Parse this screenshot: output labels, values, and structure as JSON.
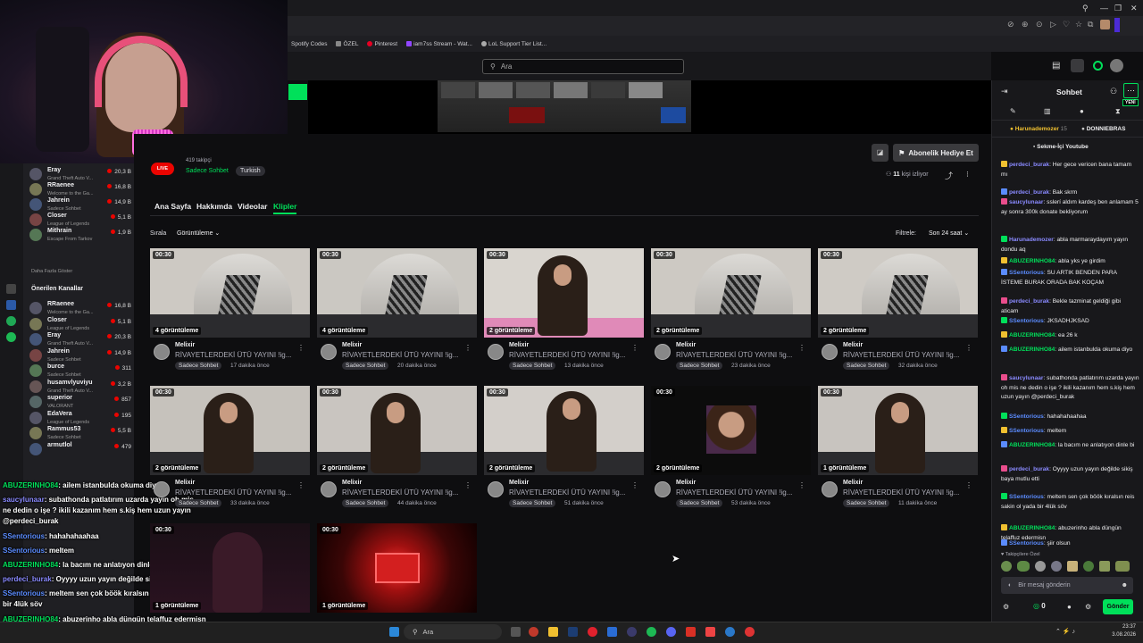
{
  "browser": {
    "bookmarks": [
      "Spotify Codes",
      "ÖZEL",
      "Pinterest",
      "iam7ss Stream - Wat...",
      "LoL Support Tier List..."
    ]
  },
  "topnav": {
    "search_placeholder": "Ara"
  },
  "channel": {
    "tags": [
      "Sadece Sohbet",
      "Turkish"
    ],
    "live_badge": "LIVE",
    "followers_partial": "419 takipçi",
    "gift_button": "Abonelik Hediye Et",
    "viewers_count": "11",
    "viewers_label": "kişi izliyor"
  },
  "tabs": [
    "Ana Sayfa",
    "Hakkımda",
    "Videolar",
    "Klipler"
  ],
  "active_tab": "Klipler",
  "sort": {
    "label": "Sırala",
    "value": "Görüntüleme"
  },
  "filter": {
    "label": "Filtrele:",
    "value": "Son 24 saat"
  },
  "clips": [
    {
      "dur": "00:30",
      "views": "4 görüntüleme",
      "channel": "Melixir",
      "title": "RİVAYETLERDEKİ ÜTÜ YAYINI !ig...",
      "tag": "Sadece Sohbet",
      "ago": "17 dakika önce"
    },
    {
      "dur": "00:30",
      "views": "4 görüntüleme",
      "channel": "Melixir",
      "title": "RİVAYETLERDEKİ ÜTÜ YAYINI !ig...",
      "tag": "Sadece Sohbet",
      "ago": "20 dakika önce"
    },
    {
      "dur": "00:30",
      "views": "2 görüntüleme",
      "channel": "Melixir",
      "title": "RİVAYETLERDEKİ ÜTÜ YAYINI !ig...",
      "tag": "Sadece Sohbet",
      "ago": "13 dakika önce"
    },
    {
      "dur": "00:30",
      "views": "2 görüntüleme",
      "channel": "Melixir",
      "title": "RİVAYETLERDEKİ ÜTÜ YAYINI !ig...",
      "tag": "Sadece Sohbet",
      "ago": "23 dakika önce"
    },
    {
      "dur": "00:30",
      "views": "2 görüntüleme",
      "channel": "Melixir",
      "title": "RİVAYETLERDEKİ ÜTÜ YAYINI !ig...",
      "tag": "Sadece Sohbet",
      "ago": "32 dakika önce"
    },
    {
      "dur": "00:30",
      "views": "2 görüntüleme",
      "channel": "Melixir",
      "title": "RİVAYETLERDEKİ ÜTÜ YAYINI !ig...",
      "tag": "Sadece Sohbet",
      "ago": "33 dakika önce"
    },
    {
      "dur": "00:30",
      "views": "2 görüntüleme",
      "channel": "Melixir",
      "title": "RİVAYETLERDEKİ ÜTÜ YAYINI !ig...",
      "tag": "Sadece Sohbet",
      "ago": "44 dakika önce"
    },
    {
      "dur": "00:30",
      "views": "2 görüntüleme",
      "channel": "Melixir",
      "title": "RİVAYETLERDEKİ ÜTÜ YAYINI !ig...",
      "tag": "Sadece Sohbet",
      "ago": "51 dakika önce"
    },
    {
      "dur": "00:30",
      "views": "2 görüntüleme",
      "channel": "Melixir",
      "title": "RİVAYETLERDEKİ ÜTÜ YAYINI !ig...",
      "tag": "Sadece Sohbet",
      "ago": "53 dakika önce"
    },
    {
      "dur": "00:30",
      "views": "1 görüntüleme",
      "channel": "Melixir",
      "title": "RİVAYETLERDEKİ ÜTÜ YAYINI !ig...",
      "tag": "Sadece Sohbet",
      "ago": "11 dakika önce"
    },
    {
      "dur": "00:30",
      "views": "1 görüntüleme"
    },
    {
      "dur": "00:30",
      "views": "1 görüntüleme"
    }
  ],
  "sidebar": {
    "followed": [
      {
        "name": "Eray",
        "game": "Grand Theft Auto V...",
        "viewers": "20,3 B"
      },
      {
        "name": "RRaenee",
        "game": "Welcome to the Ga...",
        "viewers": "16,8 B"
      },
      {
        "name": "Jahrein",
        "game": "Sadece Sohbet",
        "viewers": "14,9 B"
      },
      {
        "name": "Closer",
        "game": "League of Legends",
        "viewers": "5,1 B"
      },
      {
        "name": "Mithrain",
        "game": "Escape From Tarkov",
        "viewers": "1,9 B"
      }
    ],
    "more_label": "Daha Fazla Göster",
    "recommended_label": "Önerilen Kanallar",
    "recommended": [
      {
        "name": "RRaenee",
        "game": "Welcome to the Ga...",
        "viewers": "16,8 B"
      },
      {
        "name": "Closer",
        "game": "League of Legends",
        "viewers": "5,1 B"
      },
      {
        "name": "Eray",
        "game": "Grand Theft Auto V...",
        "viewers": "20,3 B"
      },
      {
        "name": "Jahrein",
        "game": "Sadece Sohbet",
        "viewers": "14,9 B"
      },
      {
        "name": "burce",
        "game": "Sadece Sohbet",
        "viewers": "311"
      },
      {
        "name": "husamvlyuviyu",
        "game": "Grand Theft Auto V...",
        "viewers": "3,2 B"
      },
      {
        "name": "superior",
        "game": "VALORANT",
        "viewers": "857"
      },
      {
        "name": "EdaVera",
        "game": "League of Legends",
        "viewers": "195"
      },
      {
        "name": "Rammus53",
        "game": "Sadece Sohbet",
        "viewers": "5,5 B"
      },
      {
        "name": "armutlol",
        "game": "",
        "viewers": "479"
      }
    ]
  },
  "chat": {
    "title": "Sohbet",
    "new_badge": "YENİ",
    "top_gifters": [
      {
        "name": "Harunademozer",
        "count": "15"
      },
      {
        "name": "DONNIEBRAS",
        "count": ""
      }
    ],
    "pinned": "Sekme-İçi Youtube",
    "messages": [
      {
        "user": "perdeci_burak",
        "color": "#8a8aff",
        "text": "Her gece vericen bana tamam mı"
      },
      {
        "user": "perdeci_burak",
        "color": "#8a8aff",
        "text": "Bak skrm"
      },
      {
        "user": "saucylunaar",
        "color": "#8a8aff",
        "text": "sslerí aldım kardeş ben anlamam 5 ay sonra 300k donate bekliyorum"
      },
      {
        "user": "Harunademozer",
        "color": "#8a8aff",
        "text": "abla marmaraydayım yayın dondu aq"
      },
      {
        "user": "ABUZERINHO84",
        "color": "#00e05a",
        "text": "abla yks ye girdim"
      },
      {
        "user": "SSentorious",
        "color": "#5b8cff",
        "text": "SU ARTIK BENDEN PARA İSTEME BURAK ORADA BAK KOÇAM"
      },
      {
        "user": "perdeci_burak",
        "color": "#8a8aff",
        "text": "Bekle tazminat geldiği gibi aticam"
      },
      {
        "user": "SSentorious",
        "color": "#5b8cff",
        "text": "JKSADHJKSAD"
      },
      {
        "user": "ABUZERINHO84",
        "color": "#00e05a",
        "text": "ea 26 k"
      },
      {
        "user": "ABUZERINHO84",
        "color": "#00e05a",
        "text": "ailem istanbulda okuma diyo"
      },
      {
        "user": "saucylunaar",
        "color": "#8a8aff",
        "text": "subathonda patlatırım uzarda yayın oh mis ne dedin o işe ? ikili kazanım hem s.kiş hem uzun yayın @perdeci_burak"
      },
      {
        "user": "SSentorious",
        "color": "#5b8cff",
        "text": "hahahahaahaa"
      },
      {
        "user": "SSentorious",
        "color": "#5b8cff",
        "text": "meltem"
      },
      {
        "user": "ABUZERINHO84",
        "color": "#00e05a",
        "text": "la bacım ne anlatıyon dinle bi"
      },
      {
        "user": "perdeci_burak",
        "color": "#8a8aff",
        "text": "Oyyyy uzun yayın değilde sikiş baya mutlu etti"
      },
      {
        "user": "SSentorious",
        "color": "#5b8cff",
        "text": "meltem sen çok böök kıralsın reis sakin ol yada bir 4lük söv"
      },
      {
        "user": "ABUZERINHO84",
        "color": "#00e05a",
        "text": "abuzerinho abla düngün telaffuz edermisn"
      },
      {
        "user": "SSentorious",
        "color": "#5b8cff",
        "text": "şiir olsun"
      }
    ],
    "emote_label": "Takipçilere Özel",
    "input_placeholder": "Bir mesaj gönderin",
    "points": "0",
    "send_button": "Gönder"
  },
  "overlay_chat": [
    {
      "user": "ABUZERINHO84",
      "color": "#00e05a",
      "text": "ailem istanbulda okuma diyo"
    },
    {
      "user": "saucylunaar",
      "color": "#8a8aff",
      "text": "subathonda patlatırım uzarda yayın oh mis"
    },
    {
      "user": "",
      "color": "#fff",
      "text": "ne dedin o işe ? ikili kazanım hem s.kiş hem uzun yayın"
    },
    {
      "user": "",
      "color": "#fff",
      "text": "@perdeci_burak"
    },
    {
      "user": "SSentorious",
      "color": "#5b8cff",
      "text": "hahahahaahaa"
    },
    {
      "user": "SSentorious",
      "color": "#5b8cff",
      "text": "meltem"
    },
    {
      "user": "ABUZERINHO84",
      "color": "#00e05a",
      "text": "la bacım ne anlatıyon dinle bi"
    },
    {
      "user": "perdeci_burak",
      "color": "#8a8aff",
      "text": "Oyyyy uzun yayın değilde sikiş baya mutlu etti"
    },
    {
      "user": "SSentorious",
      "color": "#5b8cff",
      "text": "meltem sen çok böök kıralsın reis sakin ol yada"
    },
    {
      "user": "",
      "color": "#fff",
      "text": "bir 4lük söv"
    },
    {
      "user": "ABUZERINHO84",
      "color": "#00e05a",
      "text": "abuzerinho abla düngün telaffuz edermisn"
    },
    {
      "user": "SSentorious",
      "color": "#5b8cff",
      "text": "şiir olsun"
    }
  ],
  "taskbar": {
    "search": "Ara",
    "time": "23:37",
    "date": "3.08.2026"
  },
  "colors": {
    "accent": "#00e05a",
    "live": "#eb0400",
    "bg": "#0e0e10"
  }
}
